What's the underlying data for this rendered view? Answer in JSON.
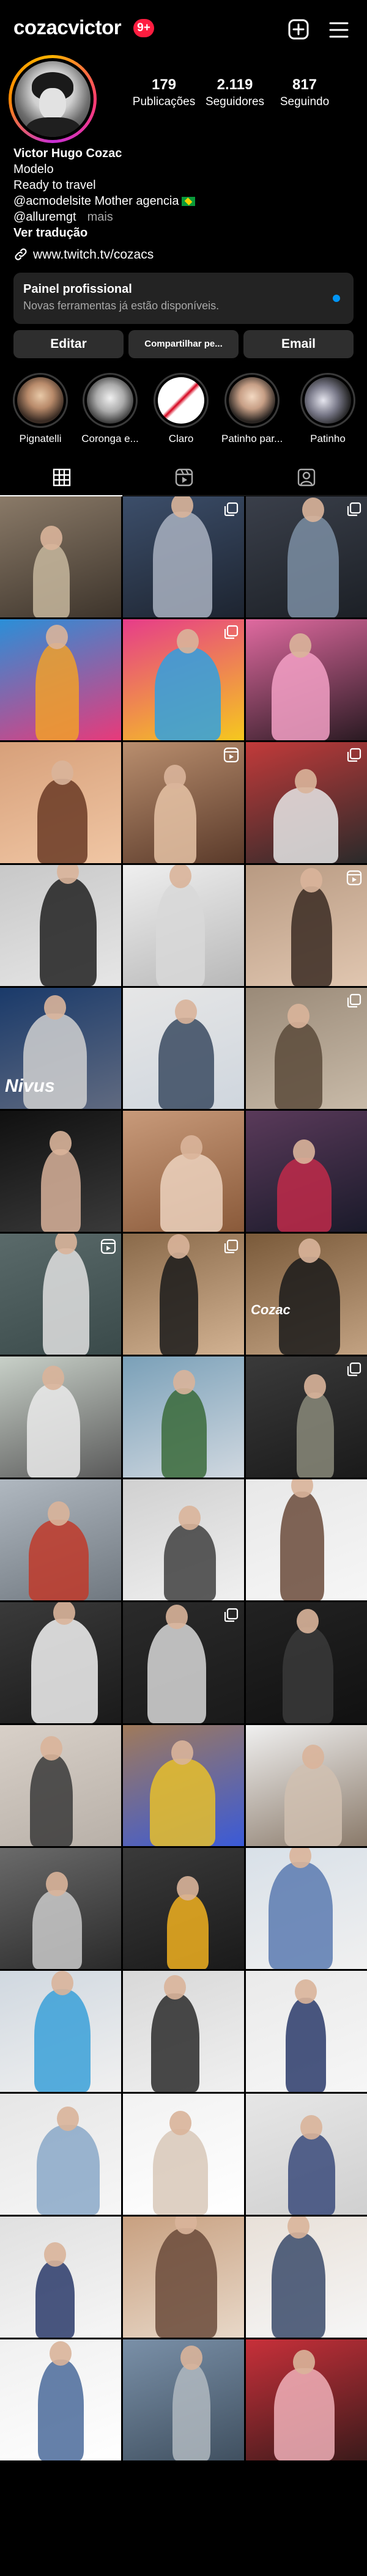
{
  "header": {
    "username": "cozacvictor",
    "notification_count": "9+",
    "icons": {
      "new_post": "plus-square-icon",
      "menu": "hamburger-menu-icon"
    }
  },
  "profile": {
    "avatar_icon": "profile-avatar",
    "stats": [
      {
        "value": "179",
        "label": "Publicações"
      },
      {
        "value": "2.119",
        "label": "Seguidores"
      },
      {
        "value": "817",
        "label": "Seguindo"
      }
    ],
    "bio": {
      "name": "Victor Hugo Cozac",
      "category": "Modelo",
      "line1": "Ready to travel",
      "line2": "@acmodelsite Mother agencia",
      "line2_flag": "brazil-flag-icon",
      "line3": "@alluremgt",
      "more": "mais",
      "translate": "Ver tradução"
    },
    "link": {
      "text": "www.twitch.tv/cozacs",
      "icon": "link-icon"
    }
  },
  "pro_panel": {
    "title": "Painel profissional",
    "subtitle": "Novas ferramentas já estão disponíveis.",
    "dot_color": "#0095f6"
  },
  "buttons": {
    "edit": "Editar",
    "share": "Compartilhar pe...",
    "email": "Email"
  },
  "highlights": [
    {
      "label": "Pignatelli"
    },
    {
      "label": "Coronga e..."
    },
    {
      "label": "Claro"
    },
    {
      "label": "Patinho par..."
    },
    {
      "label": "Patinho"
    }
  ],
  "tabs": [
    {
      "icon": "grid-icon",
      "active": true
    },
    {
      "icon": "reels-icon",
      "active": false
    },
    {
      "icon": "tagged-icon",
      "active": false
    }
  ],
  "grid": {
    "total_posts_shown": 48,
    "overlay_caption": {
      "text": "Nivus",
      "post_index": 12
    },
    "overlay_caption_2": {
      "text": "Cozac",
      "post_index": 20
    },
    "badges": {
      "carousel": "carousel-icon",
      "reel": "reel-icon"
    },
    "colors": {
      "accent_red": "#ff1d40",
      "story_ring_gradient": [
        "#ffb400",
        "#ff3c6e",
        "#c72fd6"
      ]
    }
  }
}
